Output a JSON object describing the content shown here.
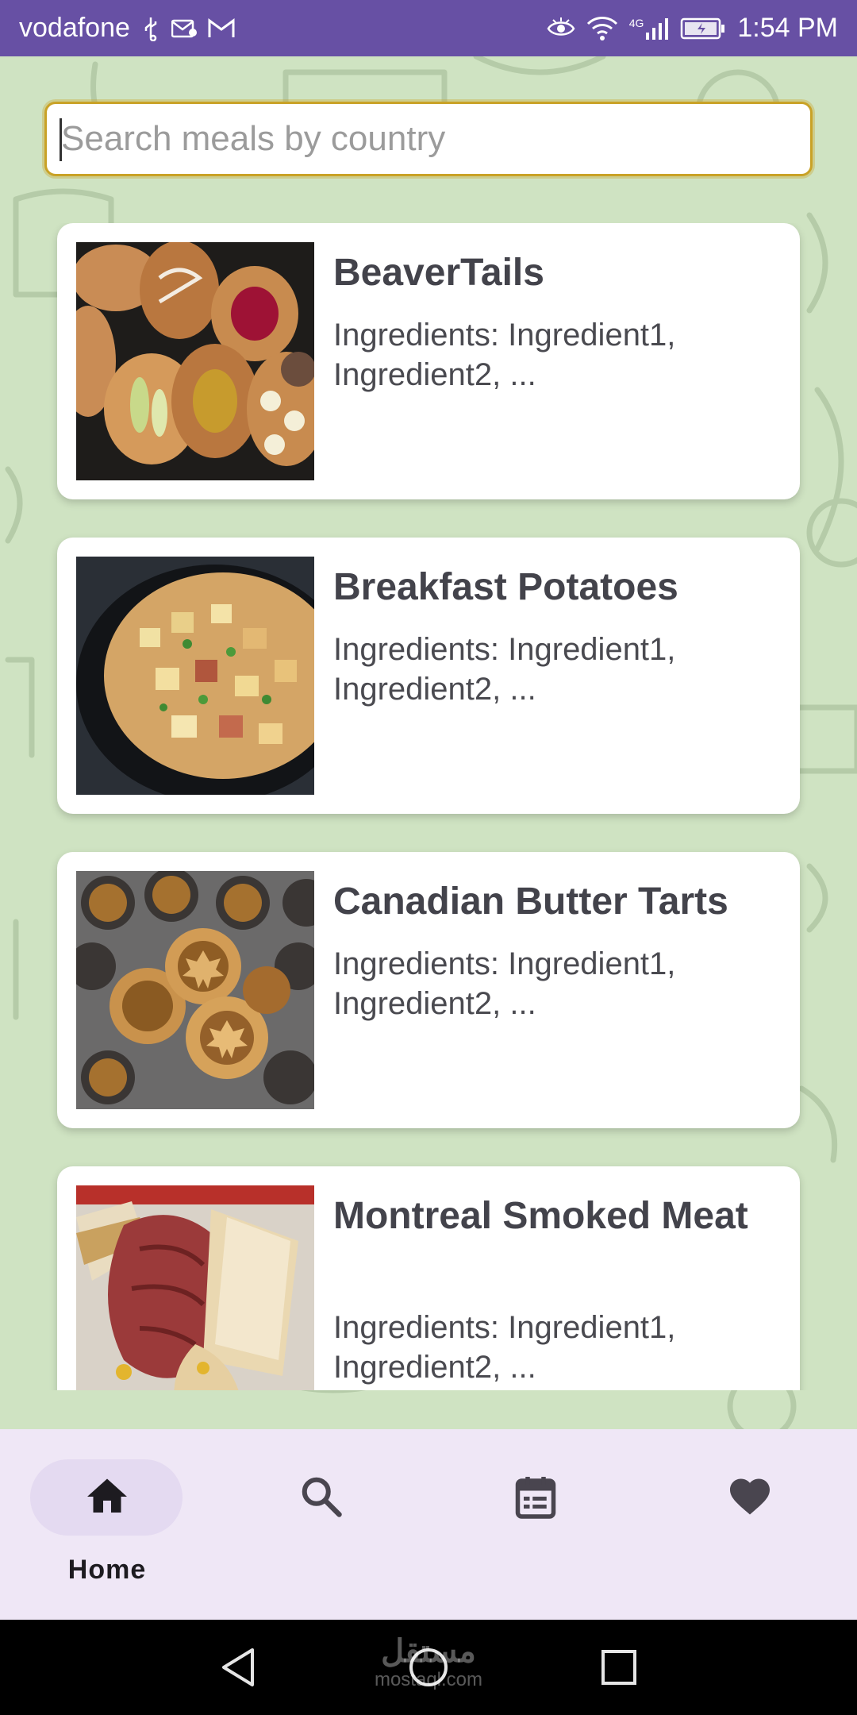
{
  "status_bar": {
    "carrier": "vodafone",
    "network": "4G",
    "time": "1:54 PM"
  },
  "search": {
    "placeholder": "Search meals by country",
    "value": ""
  },
  "meals": [
    {
      "name": "BeaverTails",
      "ingredients": "Ingredients: Ingredient1, Ingredient2, ..."
    },
    {
      "name": "Breakfast Potatoes",
      "ingredients": "Ingredients: Ingredient1, Ingredient2, ..."
    },
    {
      "name": "Canadian Butter Tarts",
      "ingredients": "Ingredients: Ingredient1, Ingredient2, ..."
    },
    {
      "name": "Montreal Smoked Meat",
      "ingredients": "Ingredients: Ingredient1, Ingredient2, ..."
    }
  ],
  "bottom_nav": {
    "items": [
      {
        "label": "Home",
        "icon": "home-icon",
        "selected": true
      },
      {
        "icon": "search-icon"
      },
      {
        "icon": "calendar-icon"
      },
      {
        "icon": "heart-icon"
      }
    ]
  },
  "watermark": {
    "arabic": "مستقل",
    "latin": "mostaql.com"
  },
  "colors": {
    "status_bar": "#6750a4",
    "background": "#cfe3c2",
    "nav_background": "#efe7f6",
    "nav_pill": "#e4daf1",
    "search_border": "#c9a227"
  }
}
